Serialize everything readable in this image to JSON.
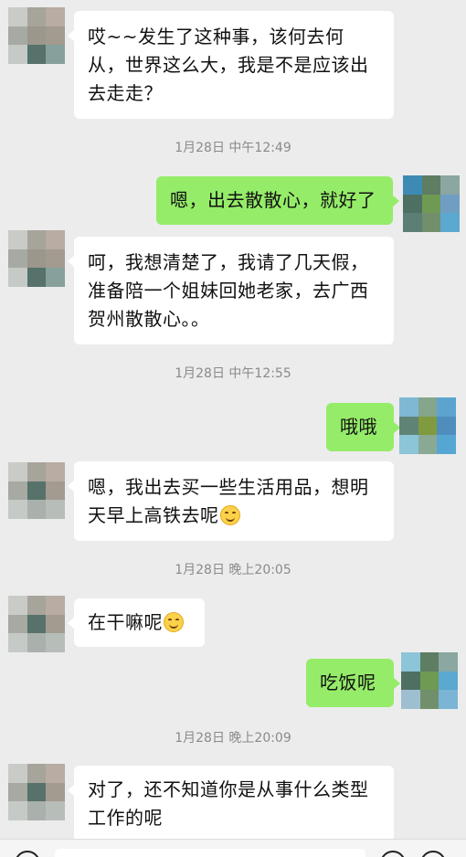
{
  "messages": [
    {
      "from": "contact",
      "text": "哎~~发生了这种事，该何去何从，世界这么大，我是不是应该出去走走？"
    },
    {
      "type": "time",
      "text": "1月28日 中午12:49"
    },
    {
      "from": "me",
      "text": "嗯，出去散散心，就好了"
    },
    {
      "from": "contact",
      "text": "呵，我想清楚了，我请了几天假，准备陪一个姐妹回她老家，去广西贺州散散心。。"
    },
    {
      "type": "time",
      "text": "1月28日 中午12:55"
    },
    {
      "from": "me",
      "text": "哦哦"
    },
    {
      "from": "contact",
      "text": "嗯，我出去买一些生活用品，想明天早上高铁去呢",
      "emoji": "smile-emoji"
    },
    {
      "type": "time",
      "text": "1月28日 晚上20:05"
    },
    {
      "from": "contact",
      "text": "在干嘛呢",
      "emoji": "smile-emoji"
    },
    {
      "from": "me",
      "text": "吃饭呢"
    },
    {
      "type": "time",
      "text": "1月28日 晚上20:09"
    },
    {
      "from": "contact",
      "text": "对了，还不知道你是从事什么类型工作的呢"
    }
  ],
  "colors": {
    "background": "#ececec",
    "incoming_bubble": "#ffffff",
    "outgoing_bubble": "#95ec69",
    "timestamp_text": "#8a8a8a"
  },
  "icons": {
    "voice": "voice-icon",
    "emoji": "emoji-icon",
    "plus": "plus-icon"
  }
}
